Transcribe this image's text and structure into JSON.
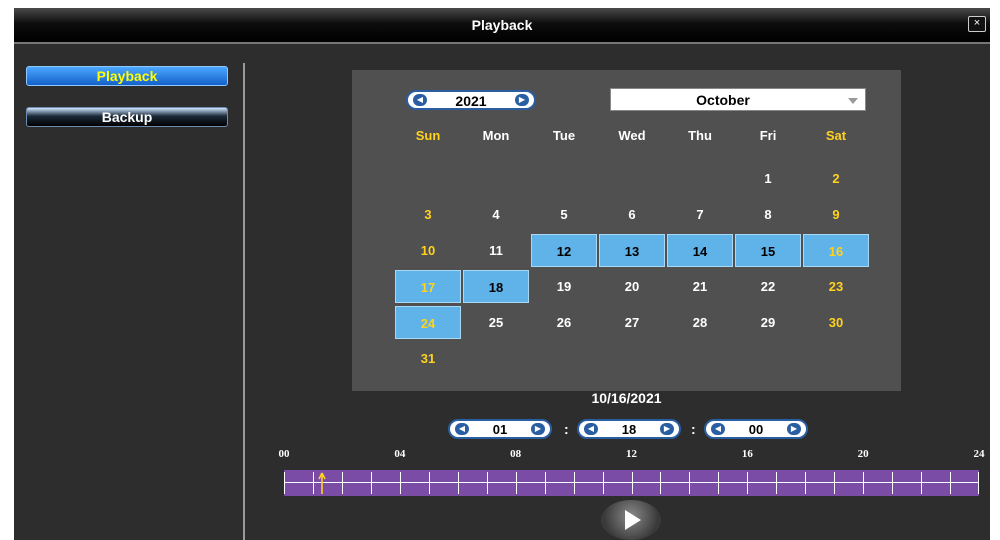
{
  "window": {
    "title": "Playback",
    "close_glyph": "×"
  },
  "sidebar": {
    "items": [
      {
        "label": "Playback",
        "active": true
      },
      {
        "label": "Backup",
        "active": false
      }
    ]
  },
  "calendar": {
    "year": "2021",
    "month": "October",
    "weekdays": [
      "Sun",
      "Mon",
      "Tue",
      "Wed",
      "Thu",
      "Fri",
      "Sat"
    ],
    "weeks": [
      [
        "",
        "",
        "",
        "",
        "",
        "1",
        "2"
      ],
      [
        "3",
        "4",
        "5",
        "6",
        "7",
        "8",
        "9"
      ],
      [
        "10",
        "11",
        "12",
        "13",
        "14",
        "15",
        "16"
      ],
      [
        "17",
        "18",
        "19",
        "20",
        "21",
        "22",
        "23"
      ],
      [
        "24",
        "25",
        "26",
        "27",
        "28",
        "29",
        "30"
      ],
      [
        "31",
        "",
        "",
        "",
        "",
        "",
        ""
      ]
    ],
    "recorded_days": [
      "12",
      "13",
      "14",
      "15",
      "16",
      "17",
      "18",
      "24"
    ]
  },
  "selected_date": "10/16/2021",
  "time": {
    "hour": "01",
    "minute": "18",
    "second": "00",
    "separator": ":"
  },
  "timeline": {
    "labels": [
      "00",
      "04",
      "08",
      "12",
      "16",
      "20",
      "24"
    ],
    "marker_hour": 1.3
  },
  "colors": {
    "recorded_day": "#5fb3e8",
    "weekend_text": "#ffd21f",
    "timeline_bar": "#7a4ca6",
    "marker": "#ffd21f"
  },
  "icons": {
    "close": "close-icon",
    "arrow_left": "arrow-left-icon",
    "arrow_right": "arrow-right-icon",
    "dropdown": "dropdown-arrow-icon",
    "play": "play-icon",
    "marker": "up-arrow-marker-icon"
  }
}
